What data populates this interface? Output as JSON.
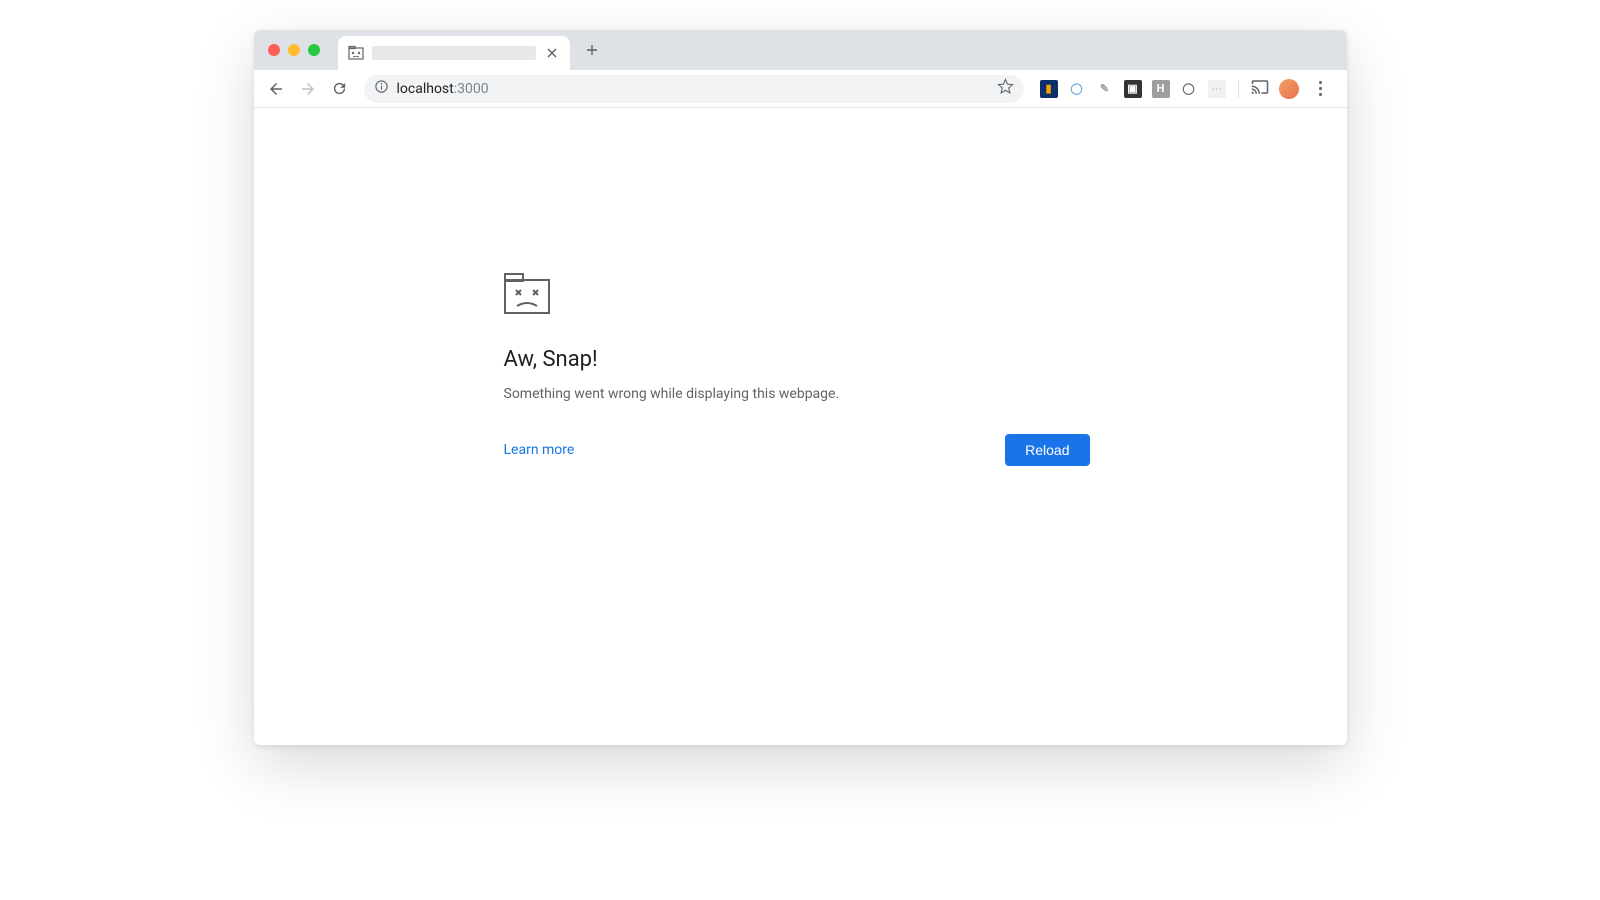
{
  "address_bar": {
    "host": "localhost",
    "port": ":3000"
  },
  "error": {
    "title": "Aw, Snap!",
    "message": "Something went wrong while displaying this webpage.",
    "learn_more_label": "Learn more",
    "reload_label": "Reload"
  },
  "extensions": [
    {
      "id": "ext-1",
      "bg": "#0b2f6b",
      "fg": "#f6a100",
      "glyph": "▮"
    },
    {
      "id": "ext-2",
      "bg": "transparent",
      "fg": "#6fa8dc",
      "glyph": "◯"
    },
    {
      "id": "ext-3",
      "bg": "transparent",
      "fg": "#9e9e9e",
      "glyph": "✎"
    },
    {
      "id": "ext-4",
      "bg": "#333333",
      "fg": "#ffffff",
      "glyph": "▣"
    },
    {
      "id": "ext-5",
      "bg": "#9e9e9e",
      "fg": "#ffffff",
      "glyph": "H"
    },
    {
      "id": "ext-6",
      "bg": "transparent",
      "fg": "#666666",
      "glyph": "◯"
    },
    {
      "id": "ext-7",
      "bg": "#f1f1f1",
      "fg": "#d0d0d0",
      "glyph": "⋯"
    }
  ]
}
